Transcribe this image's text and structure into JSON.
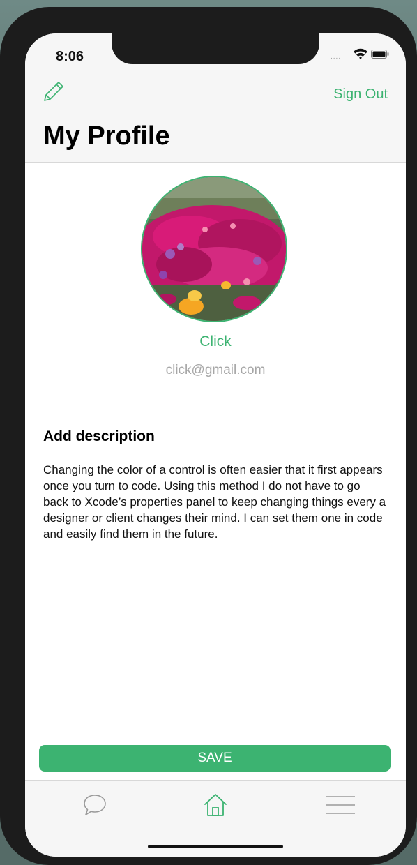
{
  "status_bar": {
    "time": "8:06",
    "signal_dots": "....."
  },
  "nav": {
    "edit_icon": "pencil-icon",
    "sign_out_label": "Sign Out",
    "title": "My Profile"
  },
  "profile": {
    "avatar": "flower-photo",
    "name": "Click",
    "email": "click@gmail.com"
  },
  "description": {
    "heading": "Add description",
    "body": "Changing the color of a control is often easier that it first appears once you turn to code. Using this method I do not have to go back to Xcode’s properties panel to keep changing things every a designer or client changes their mind. I can set them one in code and easily find them in the future."
  },
  "actions": {
    "save_label": "SAVE"
  },
  "tab_bar": {
    "items": [
      {
        "icon": "chat-bubble-icon"
      },
      {
        "icon": "home-icon"
      },
      {
        "icon": "menu-icon"
      }
    ]
  },
  "colors": {
    "accent": "#3cb371",
    "nav_background": "#f6f6f6",
    "secondary_text": "#a6a6a6"
  }
}
